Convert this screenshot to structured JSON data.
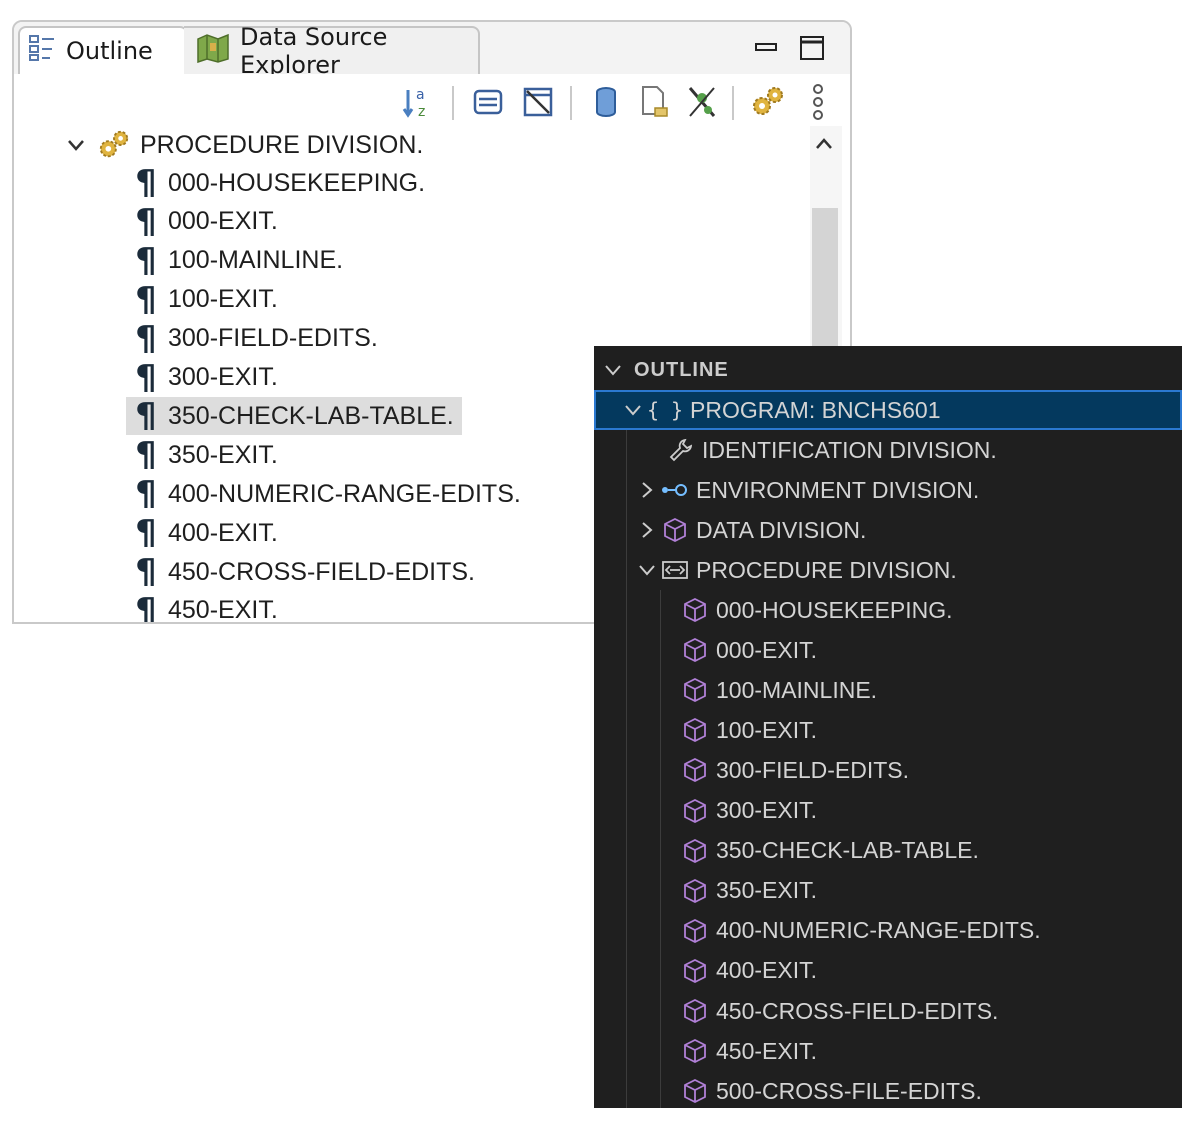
{
  "eclipse": {
    "tabs": {
      "outline": "Outline",
      "data_source": "Data Source Explorer"
    },
    "tree": {
      "root_label": "PROCEDURE DIVISION.",
      "items": [
        "000-HOUSEKEEPING.",
        "000-EXIT.",
        "100-MAINLINE.",
        "100-EXIT.",
        "300-FIELD-EDITS.",
        "300-EXIT.",
        "350-CHECK-LAB-TABLE.",
        "350-EXIT.",
        "400-NUMERIC-RANGE-EDITS.",
        "400-EXIT.",
        "450-CROSS-FIELD-EDITS.",
        "450-EXIT."
      ],
      "selected_index": 6,
      "item_symbol": "¶"
    },
    "toolbar_icons": [
      "sort-az-icon",
      "filter-icon",
      "hide-fields-icon",
      "database-icon",
      "document-icon",
      "hide-nonpublic-icon",
      "gears-icon",
      "more-icon"
    ]
  },
  "vscode": {
    "header": "OUTLINE",
    "program": {
      "braces": "{ }",
      "label": "PROGRAM: BNCHS601"
    },
    "divisions": {
      "identification": "IDENTIFICATION DIVISION.",
      "environment": "ENVIRONMENT DIVISION.",
      "data": "DATA DIVISION.",
      "procedure": "PROCEDURE DIVISION."
    },
    "paragraphs": [
      "000-HOUSEKEEPING.",
      "000-EXIT.",
      "100-MAINLINE.",
      "100-EXIT.",
      "300-FIELD-EDITS.",
      "300-EXIT.",
      "350-CHECK-LAB-TABLE.",
      "350-EXIT.",
      "400-NUMERIC-RANGE-EDITS.",
      "400-EXIT.",
      "450-CROSS-FIELD-EDITS.",
      "450-EXIT.",
      "500-CROSS-FILE-EDITS."
    ],
    "colors": {
      "background": "#1f1f1f",
      "selection": "#04395e",
      "selection_border": "#2b79d1",
      "icon_purple": "#b180d7"
    }
  }
}
